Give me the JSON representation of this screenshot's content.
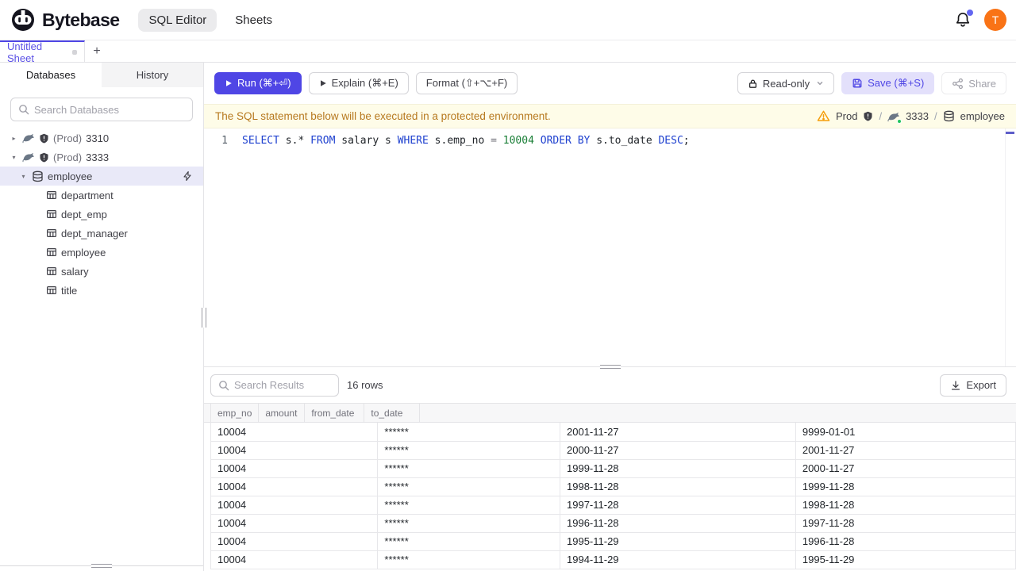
{
  "colors": {
    "accent": "#4f46e5",
    "accent-soft": "#e3e0fb",
    "banner-bg": "#fefce8",
    "banner-text": "#b7791f",
    "avatar-bg": "#f97316",
    "keyword": "#1e40cf",
    "number": "#1a7f37",
    "selected-row-bg": "#e9e9f8"
  },
  "topnav": {
    "brand": "Bytebase",
    "nav_items": [
      {
        "label": "SQL Editor",
        "active": true
      },
      {
        "label": "Sheets",
        "active": false
      }
    ],
    "avatar_initial": "T"
  },
  "sheet_tabs": {
    "active_tab": "Untitled Sheet",
    "add_label": "+"
  },
  "sidebar": {
    "tabs": [
      {
        "label": "Databases",
        "active": true
      },
      {
        "label": "History",
        "active": false
      }
    ],
    "search_placeholder": "Search Databases",
    "tree": [
      {
        "kind": "instance",
        "level": 1,
        "chevron": "right",
        "icon": "mysql-icon",
        "shield": true,
        "env": "(Prod)",
        "name": "3310"
      },
      {
        "kind": "instance",
        "level": 1,
        "chevron": "down",
        "icon": "mysql-icon",
        "shield": true,
        "env": "(Prod)",
        "name": "3333"
      },
      {
        "kind": "database",
        "level": 2,
        "chevron": "down",
        "icon": "database-icon",
        "name": "employee",
        "selected": true,
        "trailing_icon": "bolt-icon"
      },
      {
        "kind": "table",
        "level": 3,
        "icon": "table-icon",
        "name": "department"
      },
      {
        "kind": "table",
        "level": 3,
        "icon": "table-icon",
        "name": "dept_emp"
      },
      {
        "kind": "table",
        "level": 3,
        "icon": "table-icon",
        "name": "dept_manager"
      },
      {
        "kind": "table",
        "level": 3,
        "icon": "table-icon",
        "name": "employee"
      },
      {
        "kind": "table",
        "level": 3,
        "icon": "table-icon",
        "name": "salary"
      },
      {
        "kind": "table",
        "level": 3,
        "icon": "table-icon",
        "name": "title"
      }
    ]
  },
  "toolbar": {
    "run_label": "Run (⌘+⏎)",
    "explain_label": "Explain (⌘+E)",
    "format_label": "Format (⇧+⌥+F)",
    "readonly_label": "Read-only",
    "save_label": "Save (⌘+S)",
    "share_label": "Share"
  },
  "banner": {
    "message": "The SQL statement below will be executed in a protected environment.",
    "env_label": "Prod",
    "separator": "/",
    "instance": "3333",
    "database": "employee"
  },
  "editor": {
    "line_number": "1",
    "sql_text": "SELECT s.* FROM salary s WHERE s.emp_no = 10004 ORDER BY s.to_date DESC;",
    "tokens": [
      {
        "text": "SELECT",
        "style": "kw"
      },
      {
        "text": " s.* ",
        "style": "plain"
      },
      {
        "text": "FROM",
        "style": "kw"
      },
      {
        "text": " salary s ",
        "style": "plain"
      },
      {
        "text": "WHERE",
        "style": "kw"
      },
      {
        "text": " s.emp_no ",
        "style": "plain"
      },
      {
        "text": "=",
        "style": "op"
      },
      {
        "text": " ",
        "style": "plain"
      },
      {
        "text": "10004",
        "style": "num"
      },
      {
        "text": " ",
        "style": "plain"
      },
      {
        "text": "ORDER BY",
        "style": "kw"
      },
      {
        "text": " s.to_date ",
        "style": "plain"
      },
      {
        "text": "DESC",
        "style": "kw"
      },
      {
        "text": ";",
        "style": "plain"
      }
    ]
  },
  "results": {
    "search_placeholder": "Search Results",
    "row_count_label": "16 rows",
    "export_label": "Export",
    "table": {
      "columns": [
        "emp_no",
        "amount",
        "from_date",
        "to_date"
      ],
      "rows": [
        [
          "10004",
          "******",
          "2001-11-27",
          "9999-01-01"
        ],
        [
          "10004",
          "******",
          "2000-11-27",
          "2001-11-27"
        ],
        [
          "10004",
          "******",
          "1999-11-28",
          "2000-11-27"
        ],
        [
          "10004",
          "******",
          "1998-11-28",
          "1999-11-28"
        ],
        [
          "10004",
          "******",
          "1997-11-28",
          "1998-11-28"
        ],
        [
          "10004",
          "******",
          "1996-11-28",
          "1997-11-28"
        ],
        [
          "10004",
          "******",
          "1995-11-29",
          "1996-11-28"
        ],
        [
          "10004",
          "******",
          "1994-11-29",
          "1995-11-29"
        ]
      ]
    }
  }
}
